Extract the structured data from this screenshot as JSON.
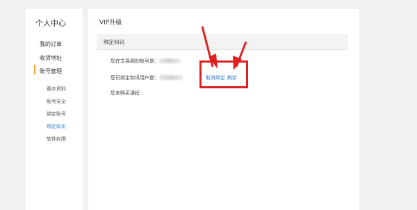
{
  "sidebar": {
    "title": "个人中心",
    "items": [
      {
        "label": "我的订单"
      },
      {
        "label": "收货地址"
      },
      {
        "label": "账号管理"
      }
    ],
    "sub_items": [
      {
        "label": "基本资料"
      },
      {
        "label": "账号安全"
      },
      {
        "label": "绑定账号"
      },
      {
        "label": "绑定和讯"
      },
      {
        "label": "软件权限"
      }
    ]
  },
  "main": {
    "title": "VIP升级",
    "section_title": "绑定和讯",
    "rows": [
      {
        "label": "您在文易阁的账号是："
      },
      {
        "label": "您已绑定和讯用户是："
      },
      {
        "label": "您未购买课程"
      }
    ],
    "unbind_link": "取消绑定",
    "refresh_link": "刷新"
  },
  "colors": {
    "accent": "#f0a030",
    "link": "#2f7dd6",
    "annotation": "#e02020"
  }
}
